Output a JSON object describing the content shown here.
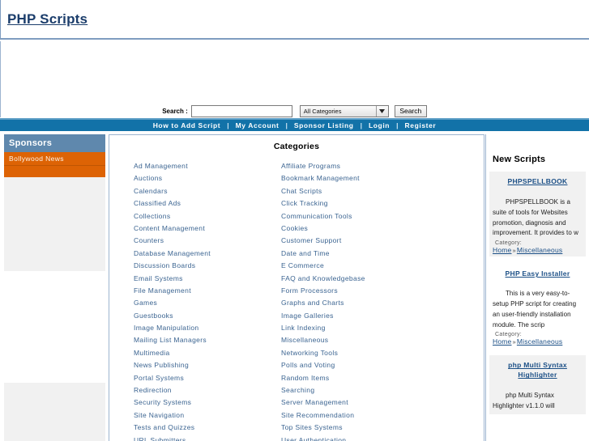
{
  "header": {
    "site_title": "PHP Scripts"
  },
  "search": {
    "label": "Search :",
    "input_value": "",
    "input_placeholder": "",
    "category_selected": "All Categories",
    "button_label": "Search",
    "dropdown_icon": "chevron-down-icon"
  },
  "nav": {
    "items": [
      "How to Add Script",
      "My Account",
      "Sponsor Listing",
      "Login",
      "Register"
    ],
    "separator": "|",
    "background_color": "#1272a8"
  },
  "sidebar": {
    "sponsors_heading": "Sponsors",
    "heading_color": "#5f88ad",
    "sponsor_color": "#dd6305",
    "sponsor_links": [
      "Bollywood News"
    ]
  },
  "categories": {
    "title": "Categories",
    "link_color": "#3b6491",
    "column_left": [
      "Ad Management",
      "Auctions",
      "Calendars",
      "Classified Ads",
      "Collections",
      "Content Management",
      "Counters",
      "Database Management",
      "Discussion Boards",
      "Email Systems",
      "File Management",
      "Games",
      "Guestbooks",
      "Image Manipulation",
      "Mailing List Managers",
      "Multimedia",
      "News Publishing",
      "Portal Systems",
      "Redirection",
      "Security Systems",
      "Site Navigation",
      "Tests and Quizzes",
      "URL Submitters"
    ],
    "column_right": [
      "Affiliate Programs",
      "Bookmark Management",
      "Chat Scripts",
      "Click Tracking",
      "Communication Tools",
      "Cookies",
      "Customer Support",
      "Date and Time",
      "E Commerce",
      "FAQ and Knowledgebase",
      "Form Processors",
      "Graphs and Charts",
      "Image Galleries",
      "Link Indexing",
      "Miscellaneous",
      "Networking Tools",
      "Polls and Voting",
      "Random Items",
      "Searching",
      "Server Management",
      "Site Recommendation",
      "Top Sites Systems",
      "User Authentication"
    ]
  },
  "new_scripts": {
    "title": "New Scripts",
    "category_label": "Category:",
    "crumb_separator": "»",
    "items": [
      {
        "title": "PHPSPELLBOOK",
        "description": "PHPSPELLBOOK is a suite of tools for Websites promotion, diagnosis and improvement. It provides to w",
        "crumb_root": "Home",
        "crumb_leaf": "Miscellaneous"
      },
      {
        "title": "PHP Easy Installer",
        "description": "This is a very easy-to-setup PHP script for creating an user-friendly installation module. The scrip",
        "crumb_root": "Home",
        "crumb_leaf": "Miscellaneous"
      },
      {
        "title": "php Multi Syntax Highlighter",
        "description": "php Multi Syntax Highlighter v1.1.0 will",
        "crumb_root": "",
        "crumb_leaf": ""
      }
    ]
  }
}
